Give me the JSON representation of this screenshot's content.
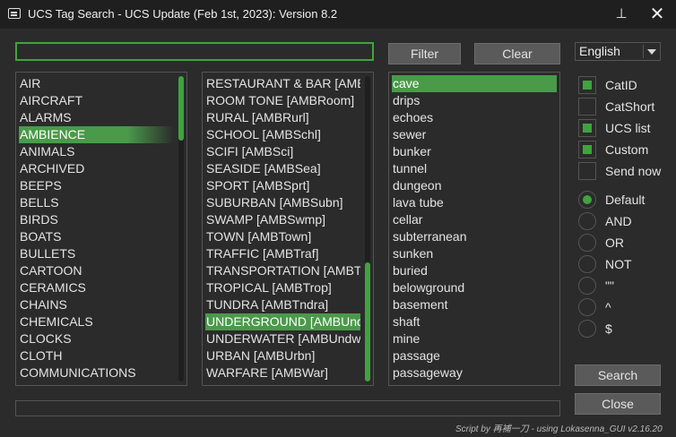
{
  "window": {
    "title": "UCS Tag Search - UCS Update (Feb 1st, 2023): Version 8.2",
    "pin_glyph": "⊥",
    "close_glyph": "✕"
  },
  "search": {
    "value": "",
    "placeholder": ""
  },
  "toolbar": {
    "filter_label": "Filter",
    "clear_label": "Clear"
  },
  "language": {
    "selected": "English"
  },
  "categories": {
    "items": [
      "AIR",
      "AIRCRAFT",
      "ALARMS",
      "AMBIENCE",
      "ANIMALS",
      "ARCHIVED",
      "BEEPS",
      "BELLS",
      "BIRDS",
      "BOATS",
      "BULLETS",
      "CARTOON",
      "CERAMICS",
      "CHAINS",
      "CHEMICALS",
      "CLOCKS",
      "CLOTH",
      "COMMUNICATIONS"
    ],
    "selected": "AMBIENCE",
    "scroll_position": 0.0,
    "scroll_visible_fraction": 0.21
  },
  "subcategories": {
    "items": [
      "RESTAURANT & BAR [AMBRest]",
      "ROOM TONE [AMBRoom]",
      "RURAL [AMBRurl]",
      "SCHOOL [AMBSchl]",
      "SCIFI [AMBSci]",
      "SEASIDE [AMBSea]",
      "SPORT [AMBSprt]",
      "SUBURBAN [AMBSubn]",
      "SWAMP [AMBSwmp]",
      "TOWN [AMBTown]",
      "TRAFFIC [AMBTraf]",
      "TRANSPORTATION [AMBTran]",
      "TROPICAL [AMBTrop]",
      "TUNDRA [AMBTndra]",
      "UNDERGROUND [AMBUnd]",
      "UNDERWATER [AMBUndwtr]",
      "URBAN [AMBUrbn]",
      "WARFARE [AMBWar]"
    ],
    "selected": "UNDERGROUND [AMBUnd]",
    "scroll_position": 1.0,
    "scroll_visible_fraction": 0.39
  },
  "synonyms": {
    "items": [
      "cave",
      "drips",
      "echoes",
      "sewer",
      "bunker",
      "tunnel",
      "dungeon",
      "lava tube",
      "cellar",
      "subterranean",
      "sunken",
      "buried",
      "belowground",
      "basement",
      "shaft",
      "mine",
      "passage",
      "passageway"
    ],
    "selected": "cave"
  },
  "options": [
    {
      "label": "CatID",
      "checked": true
    },
    {
      "label": "CatShort",
      "checked": false
    },
    {
      "label": "UCS list",
      "checked": true
    },
    {
      "label": "Custom",
      "checked": true
    },
    {
      "label": "Send now",
      "checked": false
    }
  ],
  "modes": {
    "items": [
      "Default",
      "AND",
      "OR",
      "NOT",
      "\"\"",
      "^",
      "$"
    ],
    "selected": "Default"
  },
  "actions": {
    "search_label": "Search",
    "close_label": "Close"
  },
  "status": {
    "text": ""
  },
  "credit": "Script by 再補一刀 - using Lokasenna_GUI v2.16.20",
  "colors": {
    "accent": "#3fa33f",
    "selected_row": "#4a9a4a",
    "background": "#2b2b2b",
    "titlebar": "#1f1f1f",
    "button": "#5a5a5a"
  }
}
